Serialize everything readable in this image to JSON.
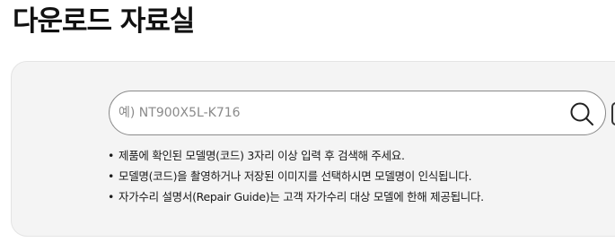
{
  "page": {
    "title": "다운로드 자료실"
  },
  "search": {
    "placeholder": "예) NT900X5L-K716",
    "value": "",
    "button_icon": "search-icon",
    "side_icon": "camera-icon"
  },
  "notes": {
    "bullet": "•",
    "items": [
      "제품에 확인된 모델명(코드) 3자리 이상 입력 후 검색해 주세요.",
      "모델명(코드)을 촬영하거나 저장된 이미지를 선택하시면 모델명이 인식됩니다.",
      "자가수리 설명서(Repair Guide)는 고객 자가수리 대상 모델에 한해 제공됩니다."
    ]
  },
  "colors": {
    "panel_background": "#f4f4f4",
    "panel_border": "#e4e4e4",
    "search_border": "#8a8a8a",
    "text": "#1a1a1a"
  }
}
